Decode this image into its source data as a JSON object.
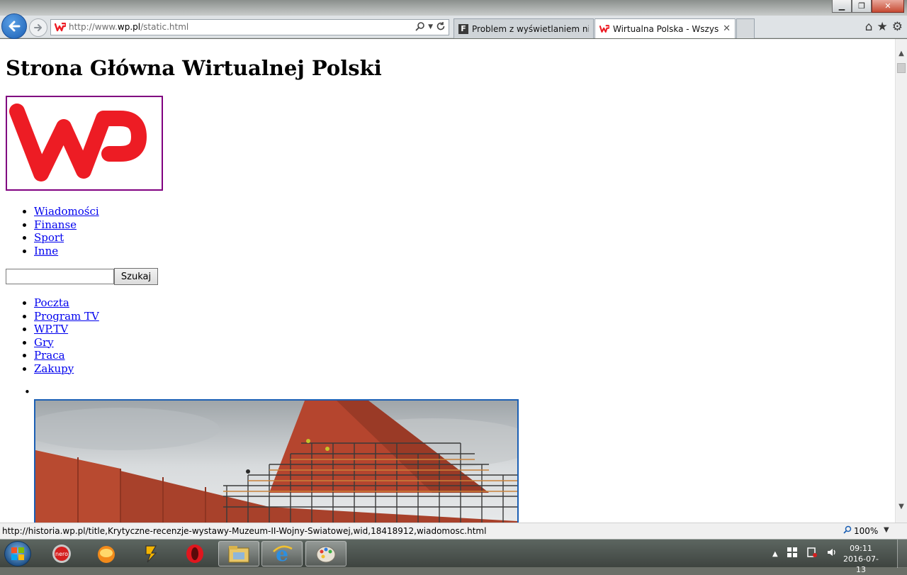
{
  "browser": {
    "address_url_prefix": "http://www.",
    "address_url_domain": "wp.pl",
    "address_url_suffix": "/static.html",
    "tabs": [
      {
        "label": "Problem z wyświetlaniem niekt...",
        "favicon": "F"
      },
      {
        "label": "Wirtualna Polska - Wszystk...",
        "favicon": "WP",
        "active": true
      }
    ],
    "window_buttons": {
      "minimize": "▁",
      "maximize": "❐",
      "close": "✕"
    }
  },
  "page": {
    "title": "Strona Główna Wirtualnej Polski",
    "logo_alt": "WP",
    "nav": [
      "Wiadomości",
      "Finanse",
      "Sport",
      "Inne"
    ],
    "search": {
      "value": "",
      "button_label": "Szukaj"
    },
    "services": [
      "Poczta",
      "Program TV",
      "WP.TV",
      "Gry",
      "Praca",
      "Zakupy"
    ],
    "photo_bullet": "•"
  },
  "statusbar": {
    "url": "http://historia.wp.pl/title,Krytyczne-recenzje-wystawy-Muzeum-II-Wojny-Swiatowej,wid,18418912,wiadomosc.html",
    "zoom": "100%"
  },
  "taskbar": {
    "apps": [
      "nero",
      "browser-globe",
      "winamp",
      "opera",
      "file-explorer",
      "internet-explorer",
      "paint"
    ],
    "clock_time": "09:11",
    "clock_date": "2016-07-13"
  },
  "colors": {
    "wp_red": "#ed1c24",
    "link": "#0000ee",
    "visited_border": "#800080"
  }
}
